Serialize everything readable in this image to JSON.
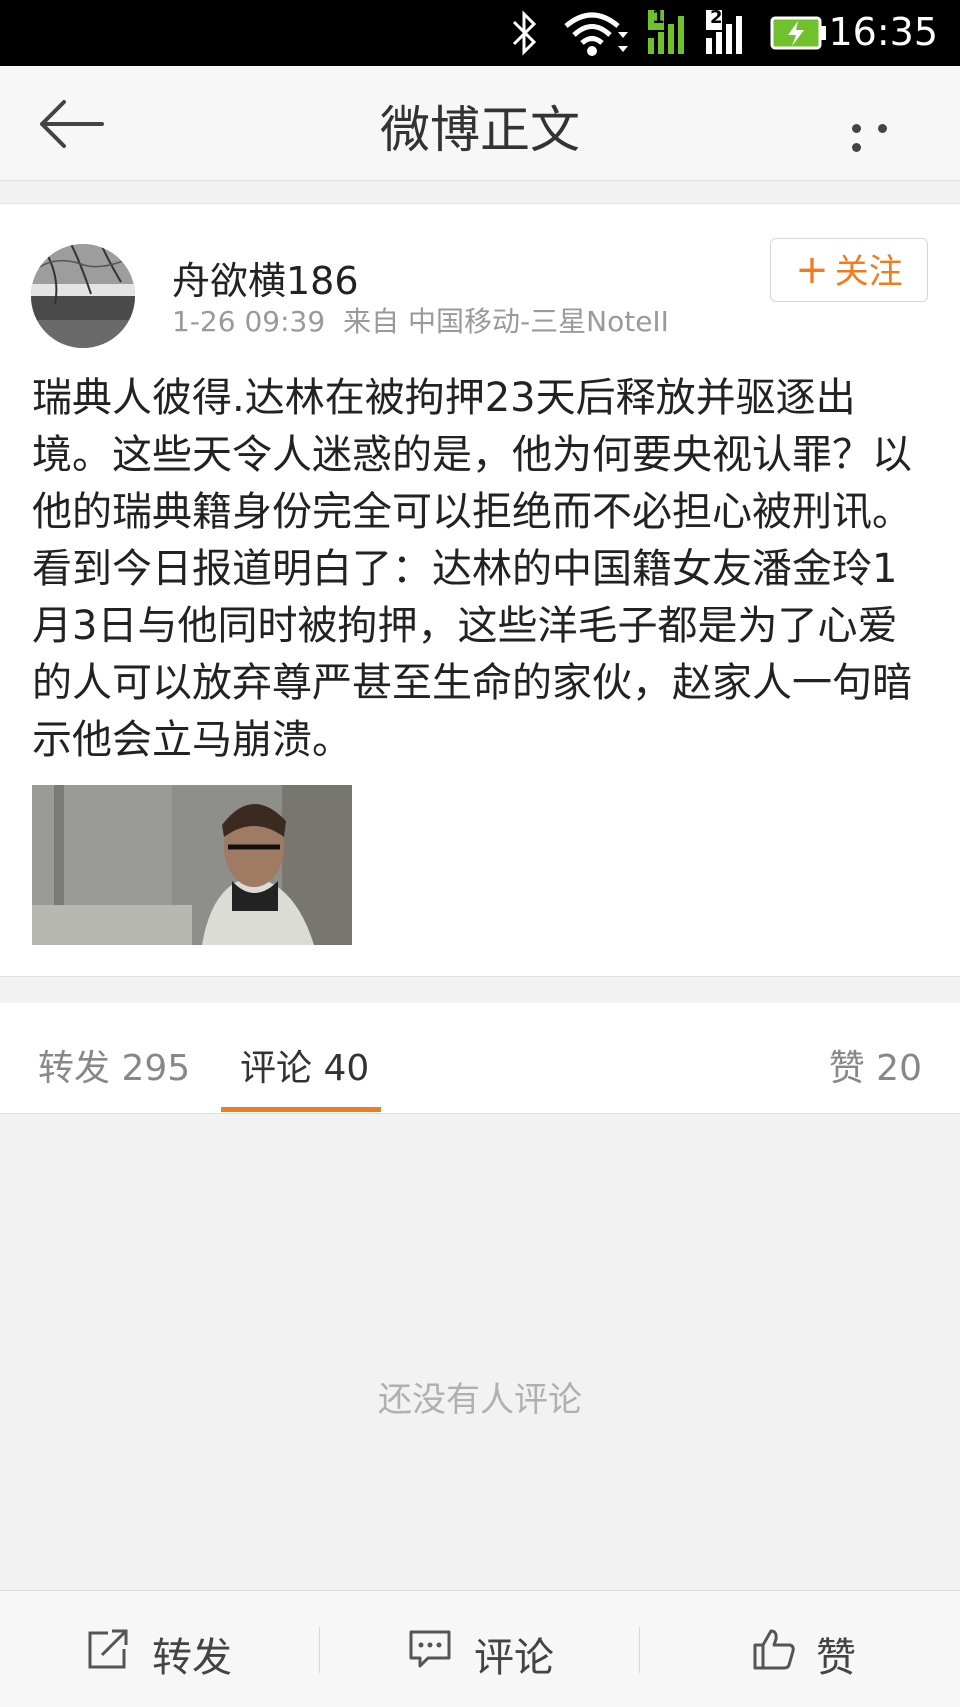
{
  "status_bar": {
    "time": "16:35",
    "sim1": "1",
    "sim2": "2"
  },
  "nav": {
    "title": "微博正文"
  },
  "post": {
    "username": "舟欲横186",
    "timestamp": "1-26 09:39",
    "source": "来自 中国移动-三星NoteII",
    "follow_label": "关注",
    "text": "瑞典人彼得.达林在被拘押23天后释放并驱逐出境。这些天令人迷惑的是，他为何要央视认罪？以他的瑞典籍身份完全可以拒绝而不必担心被刑讯。看到今日报道明白了：达林的中国籍女友潘金玲1月3日与他同时被拘押，这些洋毛子都是为了心爱的人可以放弃尊严甚至生命的家伙，赵家人一句暗示他会立马崩溃。"
  },
  "tabs": {
    "repost": "转发 295",
    "comment": "评论 40",
    "like": "赞 20"
  },
  "empty_comments": "还没有人评论",
  "toolbar": {
    "repost_label": "转发",
    "comment_label": "评论",
    "like_label": "赞"
  },
  "colors": {
    "accent": "#f07c1e",
    "statusbar": "#000000",
    "battery": "#6fc22b"
  }
}
